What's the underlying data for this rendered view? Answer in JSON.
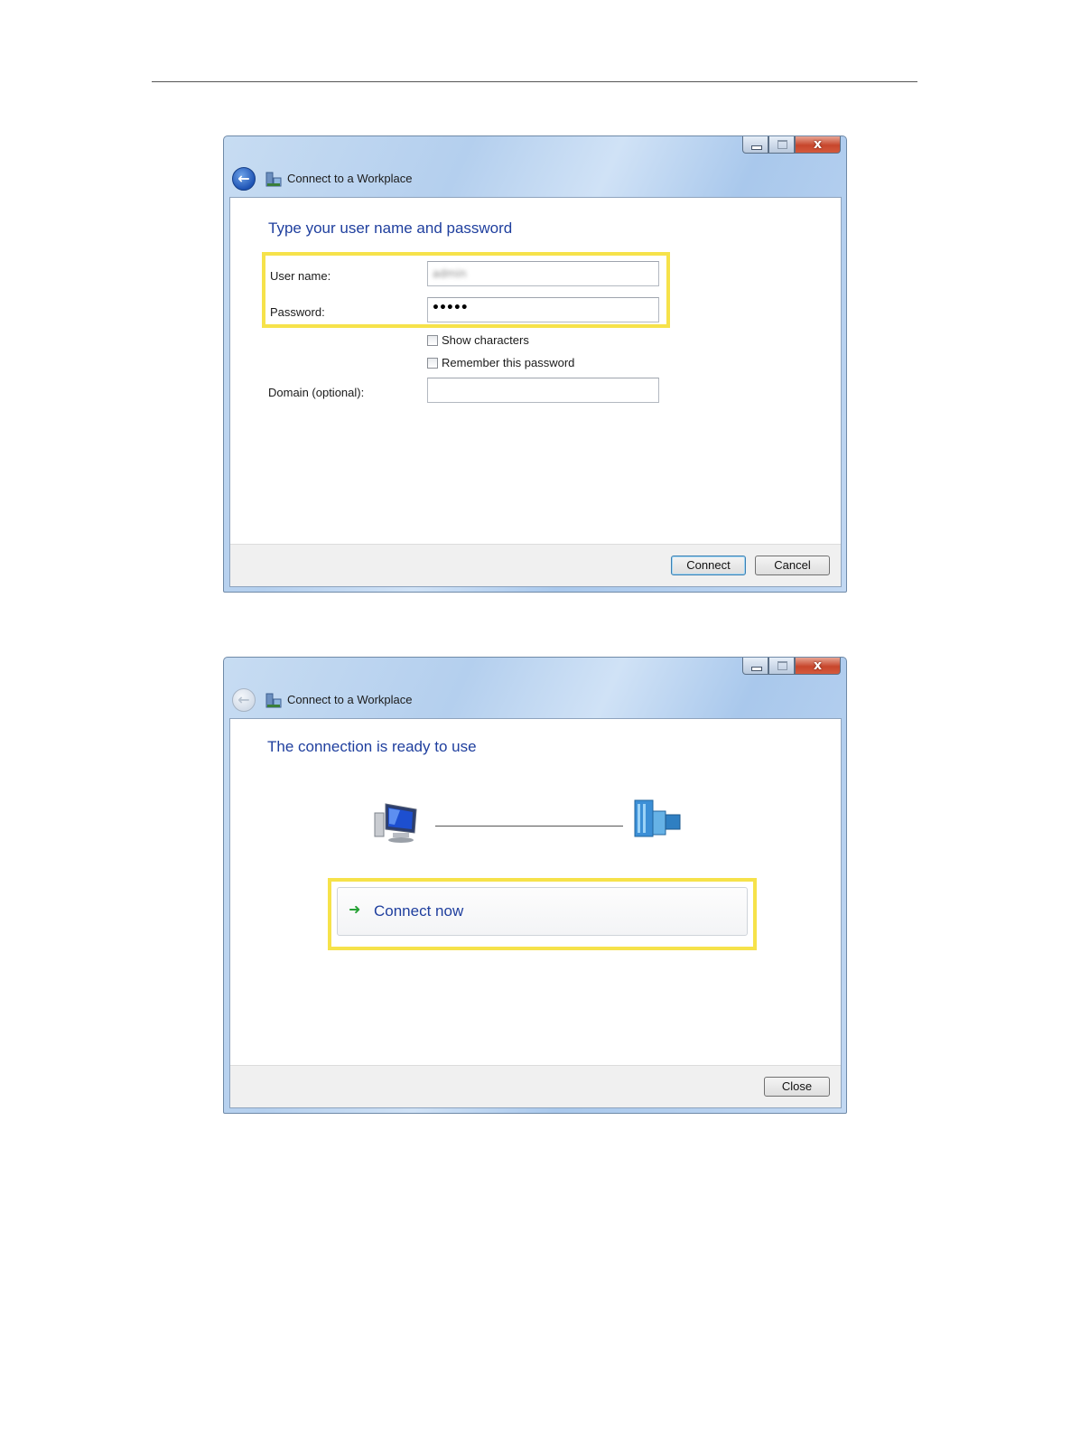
{
  "window1": {
    "title": "Connect to a Workplace",
    "heading": "Type your user name and password",
    "username_label": "User name:",
    "username_value": "admin",
    "password_label": "Password:",
    "password_value": "•••••",
    "show_characters_label": "Show characters",
    "remember_password_label": "Remember this password",
    "domain_label": "Domain (optional):",
    "domain_value": "",
    "connect_label": "Connect",
    "cancel_label": "Cancel",
    "close_glyph": "x"
  },
  "window2": {
    "title": "Connect to a Workplace",
    "heading": "The connection is ready to use",
    "connect_now_label": "Connect now",
    "close_label": "Close",
    "close_glyph": "x"
  },
  "icons": {
    "back": "back-arrow-icon",
    "app": "workplace-network-icon",
    "computer": "computer-icon",
    "server": "workplace-server-icon",
    "connect_now": "green-arrow-icon"
  },
  "colors": {
    "heading_blue": "#1f3f9e",
    "highlight_yellow": "#f6e24a",
    "arrow_green": "#27a236"
  }
}
